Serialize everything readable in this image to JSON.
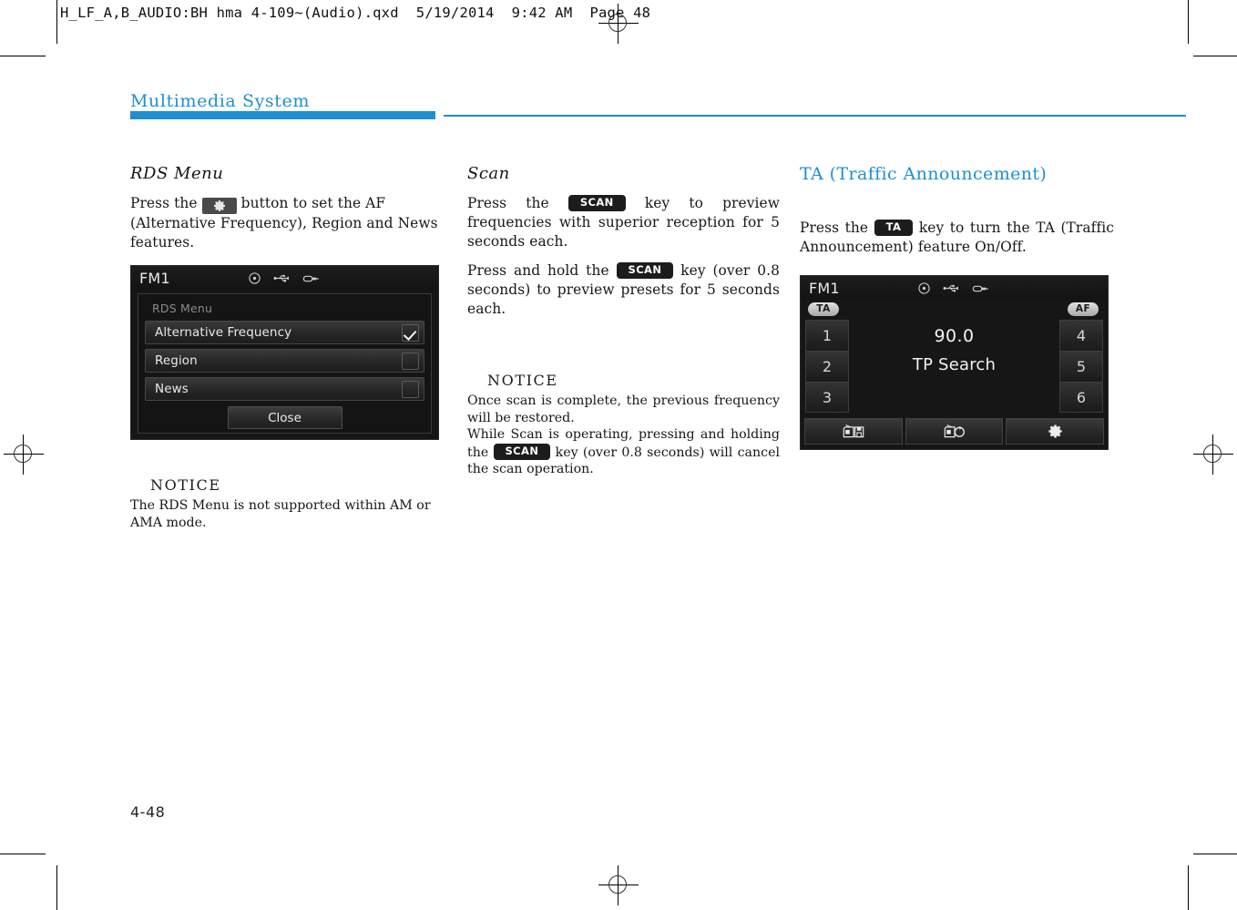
{
  "print_header": "H_LF_A,B_AUDIO:BH hma 4-109~(Audio).qxd  5/19/2014  9:42 AM  Page 48",
  "running_head": "Multimedia System",
  "folio": "4-48",
  "accent_color": "#1f8fd0",
  "columns": {
    "left": {
      "section_title": "RDS Menu",
      "intro_before_key": "Press the",
      "intro_key_icon": "gear-icon",
      "intro_after_key": "button to set the AF (Alternative Frequency), Region and News features.",
      "screen": {
        "source_label": "FM1",
        "status_icons": [
          "disc-icon",
          "usb-icon",
          "aux-plug-icon"
        ],
        "panel_caption": "RDS Menu",
        "rows": [
          {
            "label": "Alternative Frequency",
            "checked": true
          },
          {
            "label": "Region",
            "checked": false
          },
          {
            "label": "News",
            "checked": false
          }
        ],
        "close_label": "Close"
      },
      "notice": {
        "title": "NOTICE",
        "body": "The RDS Menu is not supported within AM or AMA mode."
      }
    },
    "middle": {
      "section_title": "Scan",
      "para1_before_key": "Press the",
      "para1_key": "SCAN",
      "para1_after_key": "key to preview frequencies with superior reception for 5 seconds each.",
      "para2_before_key": "Press and hold the",
      "para2_key": "SCAN",
      "para2_after_key": "key (over 0.8 seconds) to preview presets for 5 seconds each.",
      "notice": {
        "title": "NOTICE",
        "line1": "Once scan is complete, the previous frequency will be restored.",
        "line2_before_key": "While Scan is operating, pressing and holding the",
        "line2_key": "SCAN",
        "line2_after_key": "key (over 0.8 seconds) will cancel the scan operation."
      }
    },
    "right": {
      "section_title": "TA (Traffic Announcement)",
      "para_before_key": "Press the",
      "para_key": "TA",
      "para_after_key": "key to turn the TA (Traffic Announcement) feature On/Off.",
      "screen": {
        "source_label": "FM1",
        "status_icons": [
          "disc-icon",
          "usb-icon",
          "aux-plug-icon"
        ],
        "badge_left": "TA",
        "badge_right": "AF",
        "presets_left": [
          "1",
          "2",
          "3"
        ],
        "presets_right": [
          "4",
          "5",
          "6"
        ],
        "frequency": "90.0",
        "status_text": "TP Search",
        "bottom_buttons": [
          "radio-save-icon",
          "radio-scan-icon",
          "gear-icon"
        ]
      }
    }
  }
}
